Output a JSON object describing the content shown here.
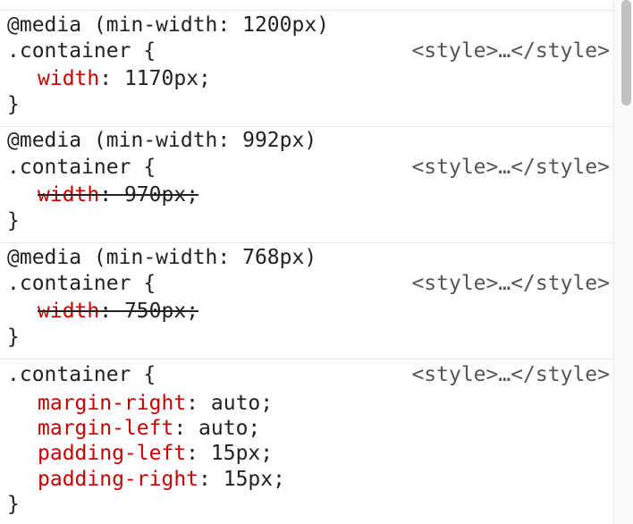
{
  "rules": [
    {
      "media": "@media (min-width: 1200px)",
      "selector": ".container {",
      "source": "<style>…</style>",
      "declarations": [
        {
          "name": "width",
          "sep": ": ",
          "value": "1170px;",
          "overridden": false
        }
      ],
      "close": "}"
    },
    {
      "media": "@media (min-width: 992px)",
      "selector": ".container {",
      "source": "<style>…</style>",
      "declarations": [
        {
          "name": "width",
          "sep": ": ",
          "value": "970px;",
          "overridden": true
        }
      ],
      "close": "}"
    },
    {
      "media": "@media (min-width: 768px)",
      "selector": ".container {",
      "source": "<style>…</style>",
      "declarations": [
        {
          "name": "width",
          "sep": ": ",
          "value": "750px;",
          "overridden": true
        }
      ],
      "close": "}"
    },
    {
      "media": "",
      "selector": ".container {",
      "source": "<style>…</style>",
      "declarations": [
        {
          "name": "margin-right",
          "sep": ": ",
          "value": "auto;",
          "overridden": false
        },
        {
          "name": "margin-left",
          "sep": ": ",
          "value": "auto;",
          "overridden": false
        },
        {
          "name": "padding-left",
          "sep": ": ",
          "value": "15px;",
          "overridden": false
        },
        {
          "name": "padding-right",
          "sep": ": ",
          "value": "15px;",
          "overridden": false
        }
      ],
      "close": "}"
    }
  ],
  "colors": {
    "property_name": "#c80000",
    "property_value": "#222222",
    "source_link": "#555555",
    "divider": "#e6e6e6"
  }
}
